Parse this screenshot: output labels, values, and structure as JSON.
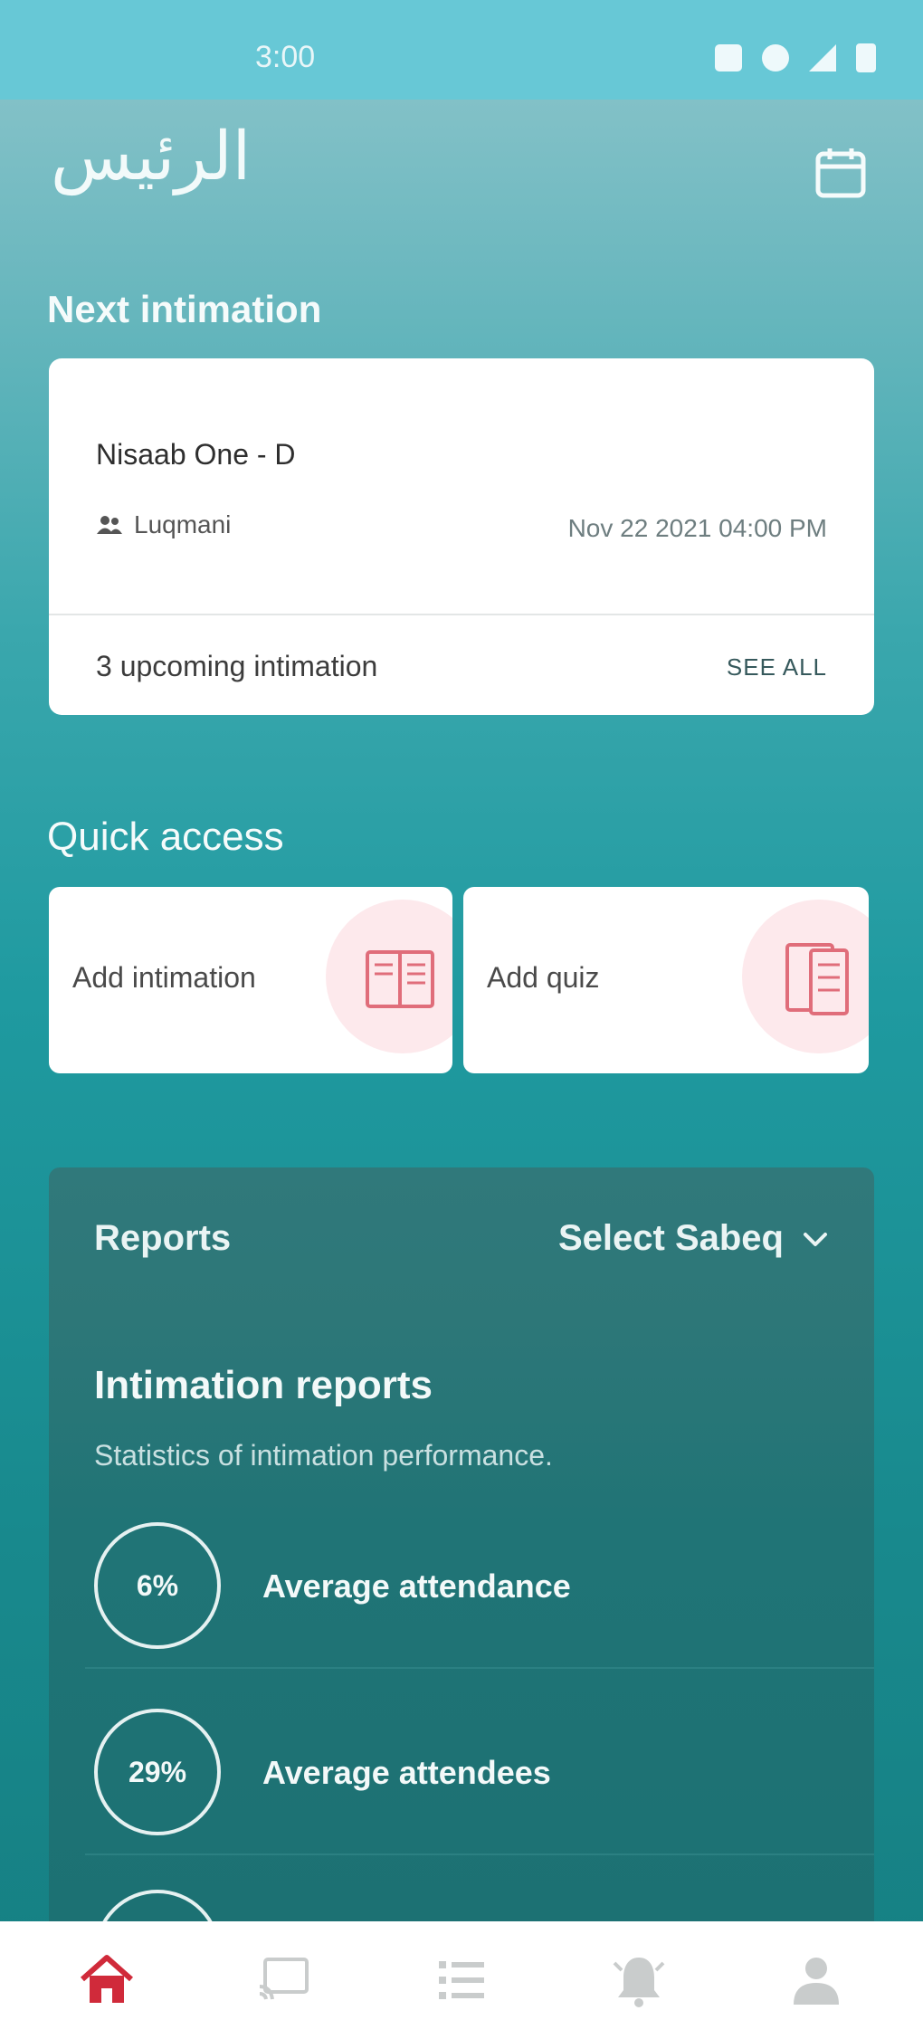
{
  "status_bar": {
    "time": "3:00"
  },
  "header": {
    "logo_text": "الرئيس"
  },
  "next_intimation": {
    "section_title": "Next intimation",
    "title": "Nisaab One - D",
    "user": "Luqmani",
    "datetime": "Nov 22 2021 04:00 PM",
    "upcoming": "3 upcoming intimation",
    "see_all": "SEE ALL"
  },
  "quick_access": {
    "section_title": "Quick access",
    "items": [
      {
        "label": "Add intimation",
        "icon": "open-book-icon"
      },
      {
        "label": "Add quiz",
        "icon": "quiz-sheet-icon"
      }
    ]
  },
  "reports": {
    "heading": "Reports",
    "select_label": "Select Sabeq",
    "title": "Intimation reports",
    "subtitle": "Statistics of intimation performance.",
    "stats": [
      {
        "value": "6%",
        "label": "Average attendance"
      },
      {
        "value": "29%",
        "label": "Average attendees"
      }
    ]
  },
  "bottom_nav": {
    "items": [
      {
        "icon": "home-icon",
        "active": true
      },
      {
        "icon": "cast-icon",
        "active": false
      },
      {
        "icon": "list-icon",
        "active": false
      },
      {
        "icon": "bell-icon",
        "active": false
      },
      {
        "icon": "profile-icon",
        "active": false
      }
    ]
  },
  "colors": {
    "accent": "#d02a3a",
    "teal": "#1f9aa0",
    "card": "#ffffff"
  }
}
